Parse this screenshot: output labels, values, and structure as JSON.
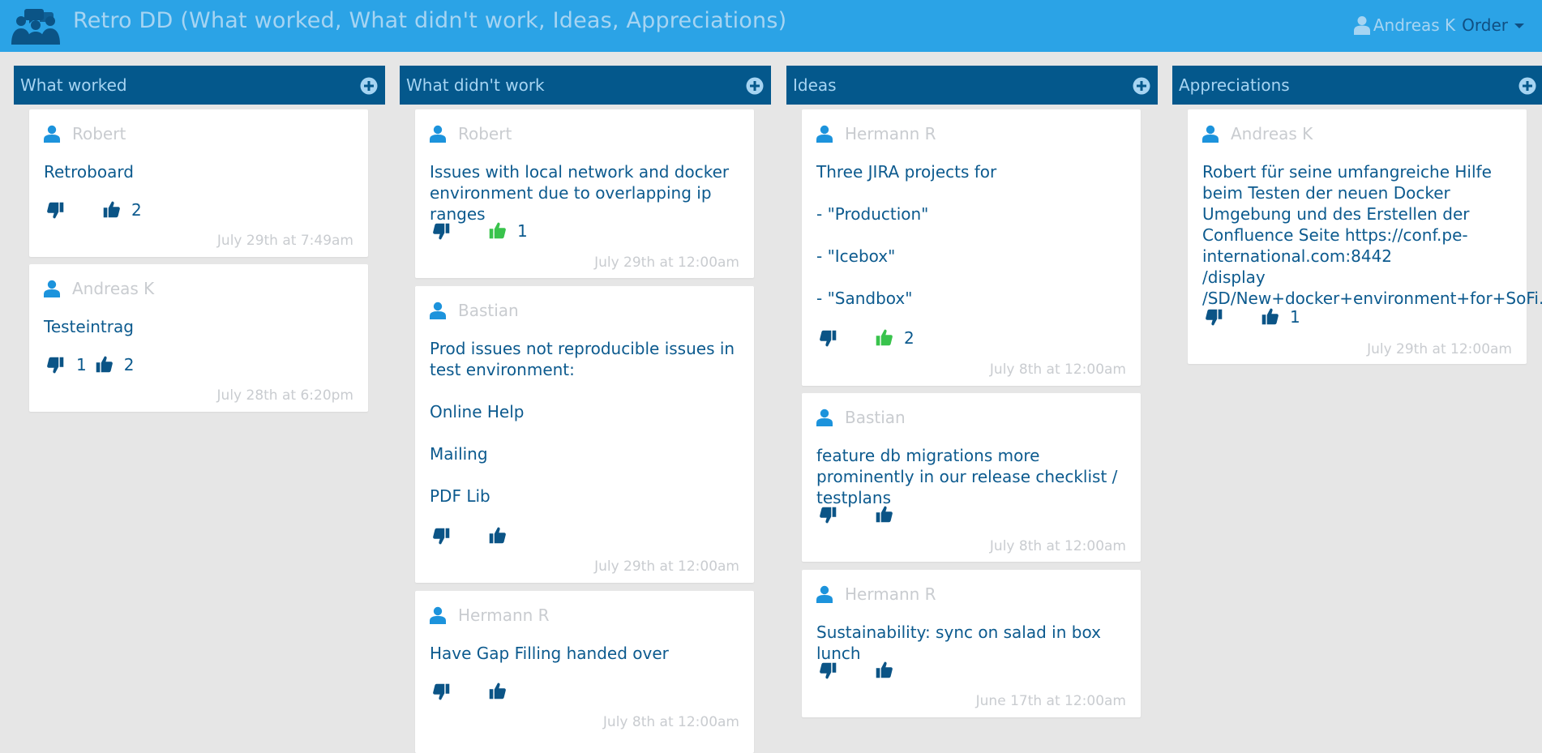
{
  "header": {
    "title": "Retro DD (What worked, What didn't work, Ideas, Appreciations)",
    "user_name": "Andreas K",
    "order_label": "Order",
    "accent": "#2ba3e6",
    "column_header_color": "#04588c",
    "up_vote_active_color": "#39c34c"
  },
  "columns": [
    {
      "title": "What worked",
      "cards": [
        {
          "author": "Robert",
          "text": "Retroboard",
          "down": "",
          "up": "2",
          "date": "July 29th at 7:49am"
        },
        {
          "author": "Andreas K",
          "text": "Testeintrag",
          "down": "1",
          "up": "2",
          "date": "July 28th at 6:20pm"
        }
      ]
    },
    {
      "title": "What didn't work",
      "cards": [
        {
          "author": "Robert",
          "text": "Issues with local network and docker environment due to overlapping ip ranges",
          "down": "",
          "up": "1",
          "date": "July 29th at 12:00am"
        },
        {
          "author": "Bastian",
          "text": "Prod issues not reproducible issues in test environment:\n\nOnline Help\n\nMailing\n\nPDF Lib",
          "down": "",
          "up": "",
          "date": "July 29th at 12:00am"
        },
        {
          "author": "Hermann R",
          "text": "Have Gap Filling handed over",
          "down": "",
          "up": "",
          "date": "July 8th at 12:00am"
        }
      ]
    },
    {
      "title": "Ideas",
      "cards": [
        {
          "author": "Hermann R",
          "text": "Three JIRA projects for\n\n- \"Production\"\n\n- \"Icebox\"\n\n- \"Sandbox\"",
          "down": "",
          "up": "2",
          "date": "July 8th at 12:00am"
        },
        {
          "author": "Bastian",
          "text": "feature db migrations more prominently in our release checklist / testplans",
          "down": "",
          "up": "",
          "date": "July 8th at 12:00am"
        },
        {
          "author": "Hermann R",
          "text": "Sustainability: sync on salad in box lunch",
          "down": "",
          "up": "",
          "date": "June 17th at 12:00am"
        }
      ]
    },
    {
      "title": "Appreciations",
      "cards": [
        {
          "author": "Andreas K",
          "text": "Robert für seine umfangreiche Hilfe beim Testen der neuen Docker Umgebung und des Erstellen der Confluence Seite https://conf.pe-international.com:8442\n/display\n/SD/New+docker+environment+for+SoFi.",
          "down": "",
          "up": "1",
          "date": "July 29th at 12:00am"
        }
      ]
    }
  ]
}
